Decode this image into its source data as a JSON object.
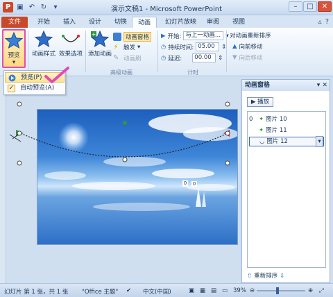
{
  "window": {
    "title": "演示文稿1 - Microsoft PowerPoint",
    "controls": [
      "–",
      "□",
      "✕"
    ]
  },
  "tabs": [
    "文件",
    "开始",
    "插入",
    "设计",
    "切换",
    "动画",
    "幻灯片放映",
    "审阅",
    "视图"
  ],
  "active_tab": "动画",
  "ribbon": {
    "preview": {
      "label": "预览",
      "caret": "▾"
    },
    "animation_styles": {
      "label": "动画样式"
    },
    "effect_options": {
      "label": "效果选项"
    },
    "add_animation": {
      "label": "添加动画"
    },
    "animation_pane": "动画窗格",
    "trigger": "触发",
    "animation_painter": "动画刷",
    "group_advanced": "高级动画",
    "start_label": "开始:",
    "start_value": "与上一动画...",
    "duration_label": "持续时间:",
    "duration_value": "05.00",
    "delay_label": "延迟:",
    "delay_value": "00.00",
    "group_timing": "计时",
    "reorder_title": "对动画重新排序",
    "move_earlier": "向前移动",
    "move_later": "向后移动"
  },
  "preview_menu": {
    "items": [
      {
        "label": "预览(P)"
      },
      {
        "label": "自动预览(A)"
      }
    ]
  },
  "animation_pane": {
    "title": "动画窗格",
    "close": "▾ ✕",
    "play_label": "播放",
    "rows": [
      {
        "num": "0",
        "label": "图片 10"
      },
      {
        "num": "",
        "label": "图片 11"
      },
      {
        "num": "",
        "label": "图片 12"
      }
    ],
    "reorder_label": "重新排序"
  },
  "status": {
    "slide_info": "幻灯片 第 1 张，共 1 张",
    "theme": "\"Office 主题\"",
    "language": "中文(中国)",
    "zoom": "39%"
  },
  "colors": {
    "file_tab": "#c8492a",
    "highlight_border": "#e24bb5",
    "ribbon_bg": "#dce8f6"
  }
}
